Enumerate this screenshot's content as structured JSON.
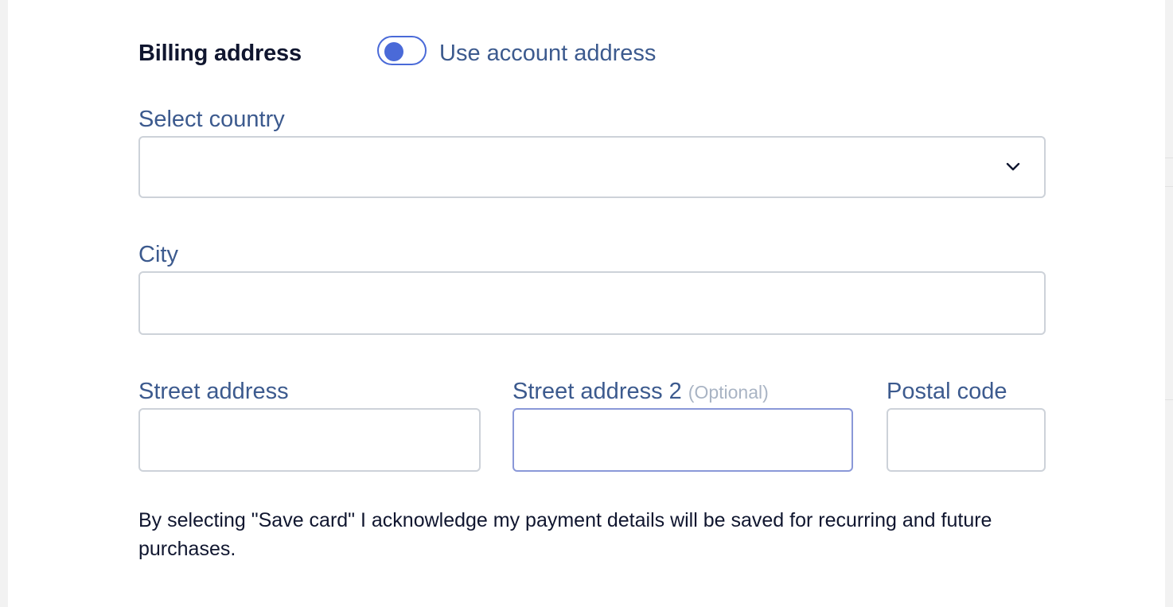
{
  "billing": {
    "title": "Billing address",
    "toggle_label": "Use account address"
  },
  "fields": {
    "country": {
      "label": "Select country",
      "value": ""
    },
    "city": {
      "label": "City",
      "value": ""
    },
    "street": {
      "label": "Street address",
      "value": ""
    },
    "street2": {
      "label": "Street address 2",
      "optional": "(Optional)",
      "value": ""
    },
    "postal": {
      "label": "Postal code",
      "value": ""
    }
  },
  "notice": "By selecting \"Save card\" I acknowledge my payment details will be saved for recurring and future purchases.",
  "icons": {
    "dropdown": "chevron-down-icon"
  },
  "colors": {
    "accent": "#4a6ad8",
    "label": "#3c5a8e",
    "text": "#10162f",
    "border": "#cdd2d9",
    "optional": "#a9b4c4"
  }
}
